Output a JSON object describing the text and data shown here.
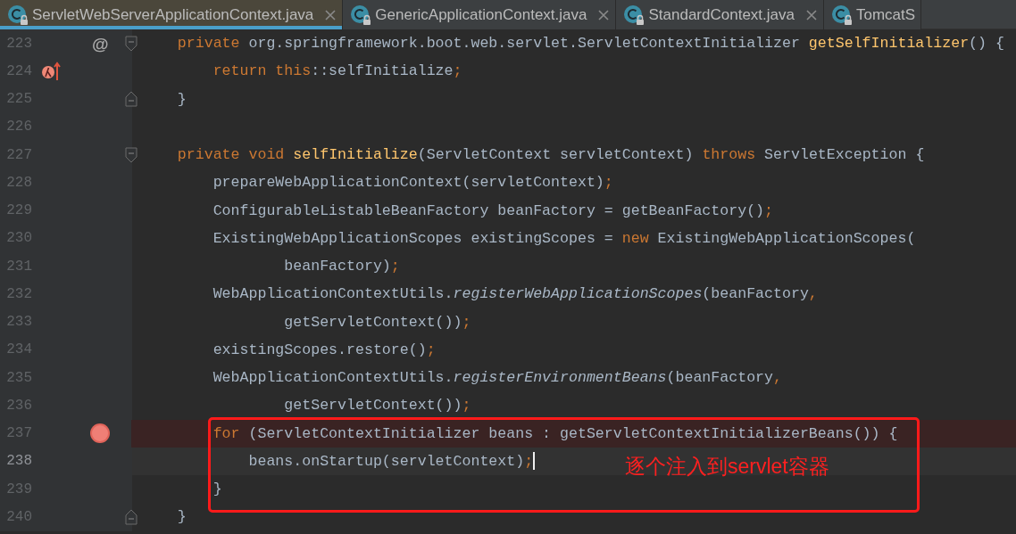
{
  "tabs": [
    {
      "label": "ServletWebServerApplicationContext.java",
      "selected": true,
      "closable": true
    },
    {
      "label": "GenericApplicationContext.java",
      "selected": false,
      "closable": true
    },
    {
      "label": "StandardContext.java",
      "selected": false,
      "closable": true
    },
    {
      "label": "TomcatS",
      "selected": false,
      "closable": false
    }
  ],
  "lines": [
    {
      "number": "223",
      "marker": {
        "kind": "override",
        "text": "@"
      },
      "fold": {
        "kind": "start"
      },
      "current": false,
      "tokens": [
        {
          "kind": "kw",
          "t": "    private "
        },
        {
          "kind": "plain",
          "t": "org.springframework.boot.web.servlet.ServletContextInitializer "
        },
        {
          "kind": "decl",
          "t": "getSelfInitializer"
        },
        {
          "kind": "plain",
          "t": "() {"
        }
      ]
    },
    {
      "number": "224",
      "marker": {
        "kind": "lambda"
      },
      "current": false,
      "tokens": [
        {
          "kind": "kw",
          "t": "        return this"
        },
        {
          "kind": "plain",
          "t": "::selfInitialize"
        },
        {
          "kind": "kw",
          "t": ";"
        }
      ]
    },
    {
      "number": "225",
      "fold": {
        "kind": "end"
      },
      "current": false,
      "tokens": [
        {
          "kind": "plain",
          "t": "    }"
        }
      ]
    },
    {
      "number": "226",
      "current": false
    },
    {
      "number": "227",
      "fold": {
        "kind": "start"
      },
      "current": false,
      "tokens": [
        {
          "kind": "kw",
          "t": "    private void "
        },
        {
          "kind": "decl",
          "t": "selfInitialize"
        },
        {
          "kind": "plain",
          "t": "(ServletContext servletContext) "
        },
        {
          "kind": "kw",
          "t": "throws "
        },
        {
          "kind": "plain",
          "t": "ServletException {"
        }
      ]
    },
    {
      "number": "228",
      "current": false,
      "tokens": [
        {
          "kind": "plain",
          "t": "        prepareWebApplicationContext(servletContext)"
        },
        {
          "kind": "kw",
          "t": ";"
        }
      ]
    },
    {
      "number": "229",
      "current": false,
      "tokens": [
        {
          "kind": "plain",
          "t": "        ConfigurableListableBeanFactory beanFactory = getBeanFactory()"
        },
        {
          "kind": "kw",
          "t": ";"
        }
      ]
    },
    {
      "number": "230",
      "current": false,
      "tokens": [
        {
          "kind": "plain",
          "t": "        ExistingWebApplicationScopes existingScopes = "
        },
        {
          "kind": "kw",
          "t": "new "
        },
        {
          "kind": "plain",
          "t": "ExistingWebApplicationScopes("
        }
      ]
    },
    {
      "number": "231",
      "current": false,
      "tokens": [
        {
          "kind": "plain",
          "t": "                beanFactory)"
        },
        {
          "kind": "kw",
          "t": ";"
        }
      ]
    },
    {
      "number": "232",
      "current": false,
      "tokens": [
        {
          "kind": "plain",
          "t": "        WebApplicationContextUtils."
        },
        {
          "kind": "static",
          "t": "registerWebApplicationScopes"
        },
        {
          "kind": "plain",
          "t": "(beanFactory"
        },
        {
          "kind": "kw",
          "t": ","
        }
      ]
    },
    {
      "number": "233",
      "current": false,
      "tokens": [
        {
          "kind": "plain",
          "t": "                getServletContext())"
        },
        {
          "kind": "kw",
          "t": ";"
        }
      ]
    },
    {
      "number": "234",
      "current": false,
      "tokens": [
        {
          "kind": "plain",
          "t": "        existingScopes.restore()"
        },
        {
          "kind": "kw",
          "t": ";"
        }
      ]
    },
    {
      "number": "235",
      "current": false,
      "tokens": [
        {
          "kind": "plain",
          "t": "        WebApplicationContextUtils."
        },
        {
          "kind": "static",
          "t": "registerEnvironmentBeans"
        },
        {
          "kind": "plain",
          "t": "(beanFactory"
        },
        {
          "kind": "kw",
          "t": ","
        }
      ]
    },
    {
      "number": "236",
      "current": false,
      "tokens": [
        {
          "kind": "plain",
          "t": "                getServletContext())"
        },
        {
          "kind": "kw",
          "t": ";"
        }
      ]
    },
    {
      "number": "237",
      "marker": {
        "kind": "breakpoint"
      },
      "current": false,
      "tokens": [
        {
          "kind": "kw",
          "t": "        for "
        },
        {
          "kind": "plain",
          "t": "(ServletContextInitializer beans : getServletContextInitializerBeans()) {"
        }
      ]
    },
    {
      "number": "238",
      "current": true,
      "tokens": [
        {
          "kind": "plain",
          "t": "            beans.onStartup(servletContext)"
        },
        {
          "kind": "kw",
          "t": ";"
        }
      ]
    },
    {
      "number": "239",
      "current": false,
      "tokens": [
        {
          "kind": "plain",
          "t": "        }"
        }
      ]
    },
    {
      "number": "240",
      "fold": {
        "kind": "end"
      },
      "current": false,
      "tokens": [
        {
          "kind": "plain",
          "t": "    }"
        }
      ]
    }
  ],
  "annotation": {
    "text": "逐个注入到servlet容器"
  }
}
